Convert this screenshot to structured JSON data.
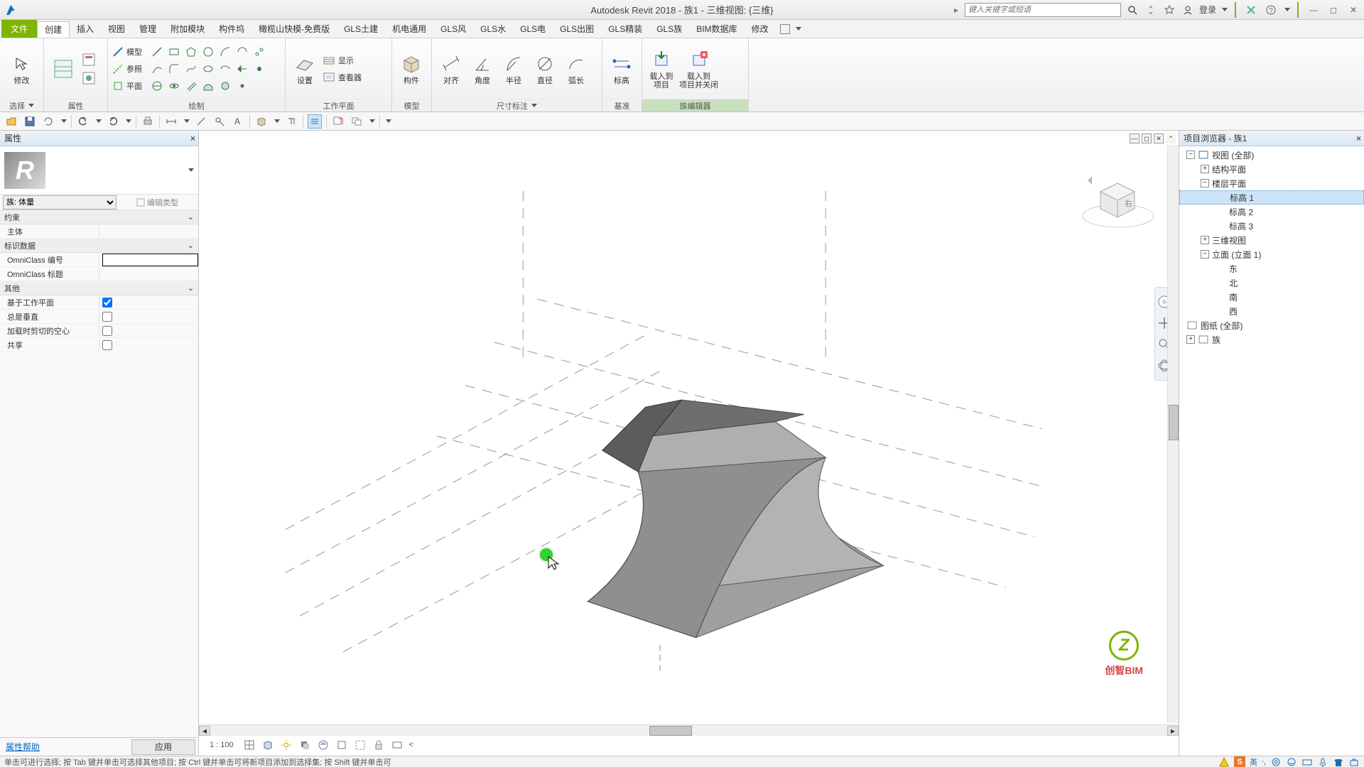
{
  "title": "Autodesk Revit 2018 -    族1 - 三维视图: {三维}",
  "search_placeholder": "键入关键字或短语",
  "login": "登录",
  "menu": {
    "file": "文件",
    "tabs": [
      "创建",
      "插入",
      "视图",
      "管理",
      "附加模块",
      "构件坞",
      "橄榄山快模-免费版",
      "GLS土建",
      "机电通用",
      "GLS风",
      "GLS水",
      "GLS电",
      "GLS出图",
      "GLS精装",
      "GLS族",
      "BIM数据库",
      "修改"
    ]
  },
  "ribbon": {
    "select": {
      "btn": "修改",
      "title": "选择"
    },
    "props_title": "属性",
    "draw": {
      "model": "模型",
      "ref": "参照",
      "plane": "平面",
      "title": "绘制"
    },
    "wp": {
      "set": "设置",
      "show": "显示",
      "viewer": "查看器",
      "title": "工作平面"
    },
    "model_btn": "构件",
    "model_title": "模型",
    "dim": {
      "align": "对齐",
      "angle": "角度",
      "radius": "半径",
      "diam": "直径",
      "arc": "弧长",
      "title": "尺寸标注"
    },
    "datum": {
      "level": "标高",
      "title": "基准"
    },
    "fam": {
      "load": "载入到\n项目",
      "loadclose": "载入到\n项目并关闭",
      "title": "族编辑器"
    }
  },
  "props": {
    "title": "属性",
    "type_combo": "族: 体量",
    "edit_type": "编辑类型",
    "cats": {
      "constraints": "约束",
      "host": "主体",
      "id": "标识数据",
      "omniclass_num": "OmniClass 编号",
      "omniclass_title": "OmniClass 标题",
      "other": "其他",
      "wp_based": "基于工作平面",
      "always_vert": "总是垂直",
      "cut_void": "加载时剪切的空心",
      "shared": "共享"
    },
    "help": "属性帮助",
    "apply": "应用"
  },
  "viewstatus": {
    "scale": "1 : 100"
  },
  "browser": {
    "title": "项目浏览器 - 族1",
    "views": "视图 (全部)",
    "struct": "结构平面",
    "floor": "楼层平面",
    "lv1": "标高 1",
    "lv2": "标高 2",
    "lv3": "标高 3",
    "d3": "三维视图",
    "elev": "立面 (立面 1)",
    "east": "东",
    "north": "北",
    "south": "南",
    "west": "西",
    "sheets": "图纸 (全部)",
    "fam": "族"
  },
  "status_text": "单击可进行选择; 按 Tab 键并单击可选择其他项目; 按 Ctrl 键并单击可将新项目添加到选择集; 按 Shift 键并单击可",
  "status_lang": "英",
  "watermark": "创智BIM"
}
